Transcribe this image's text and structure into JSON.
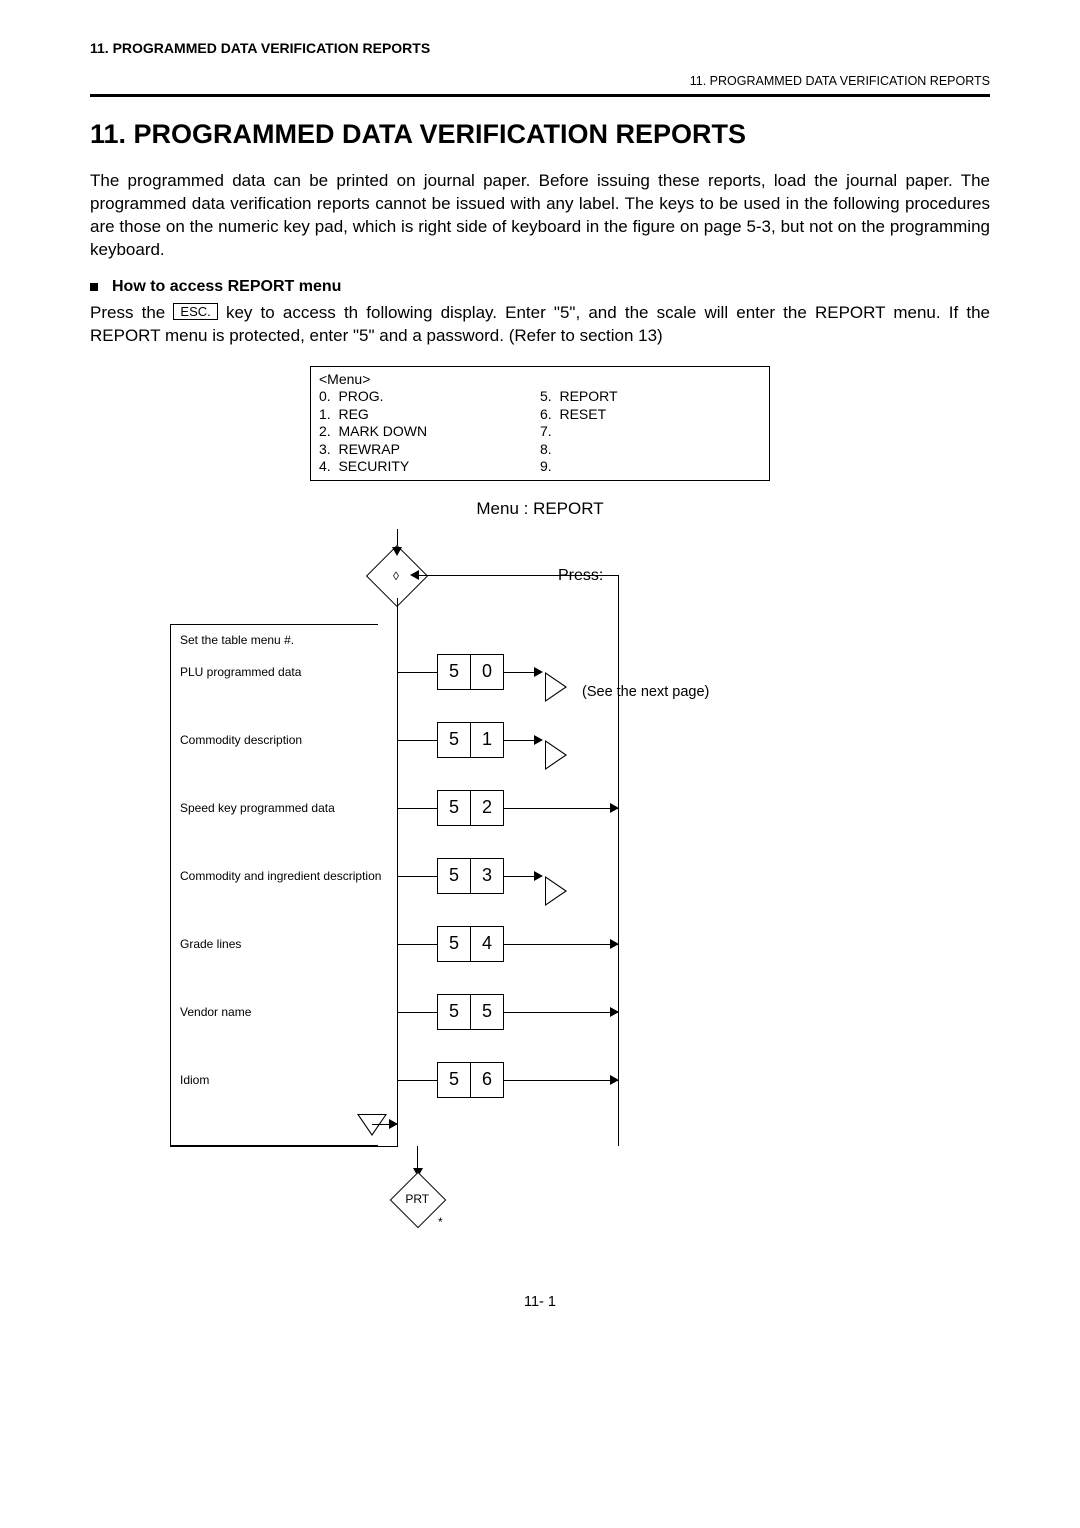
{
  "header_left": "11.   PROGRAMMED DATA VERIFICATION REPORTS",
  "header_right": "11. PROGRAMMED DATA VERIFICATION REPORTS",
  "title": "11.  PROGRAMMED DATA VERIFICATION REPORTS",
  "intro": "The programmed data can be printed on journal paper.  Before issuing these reports, load the journal paper.   The programmed data verification reports cannot be issued with any label.   The keys to be used in the following procedures are those on the numeric key pad, which is right side of keyboard in the figure on page 5-3, but not on the programming keyboard.",
  "howto_label": "How to access REPORT menu",
  "access_pre": "Press the",
  "esc_key": "ESC.",
  "access_post": "key to access th following display.   Enter \"5\", and the scale will enter the REPORT menu.   If the REPORT menu is protected, enter \"5\" and a password.   (Refer to section 13)",
  "menu_box_left": "<Menu>\n0.  PROG.\n1.  REG\n2.  MARK DOWN\n3.  REWRAP\n4.  SECURITY",
  "menu_box_right": "\n5.  REPORT\n6.  RESET\n7.\n8.\n9.",
  "menu_path": "Menu :   REPORT",
  "press": "Press:",
  "table_items": [
    {
      "label": "Set the table menu #."
    },
    {
      "label": "PLU programmed data",
      "k1": "5",
      "k2": "0",
      "u": true
    },
    {
      "label": "Commodity description",
      "k1": "5",
      "k2": "1",
      "u": true
    },
    {
      "label": "Speed key programmed data",
      "k1": "5",
      "k2": "2"
    },
    {
      "label": "Commodity and ingredient description",
      "k1": "5",
      "k2": "3",
      "u": true
    },
    {
      "label": "Grade lines",
      "k1": "5",
      "k2": "4"
    },
    {
      "label": "Vendor name",
      "k1": "5",
      "k2": "5"
    },
    {
      "label": "Idiom",
      "k1": "5",
      "k2": "6"
    }
  ],
  "see_next": "(See the next page)",
  "prt": "PRT",
  "prt_star": "*",
  "v_letter": "v",
  "u_letter": "u",
  "diamond_letter": "◊",
  "page_num": "11- 1"
}
